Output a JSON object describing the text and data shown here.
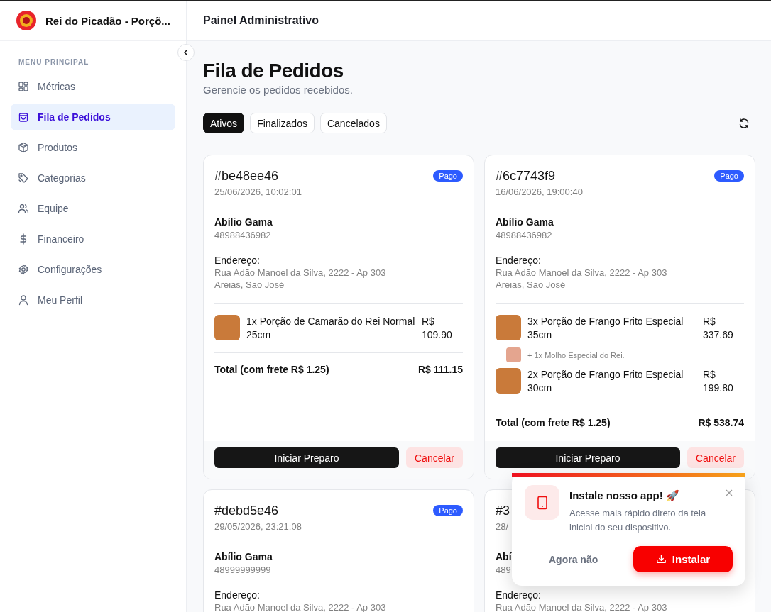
{
  "sidebar": {
    "brand": "Rei do Picadão - Porçõ...",
    "section_title": "MENU PRINCIPAL",
    "items": [
      {
        "label": "Métricas",
        "selected": false
      },
      {
        "label": "Fila de Pedidos",
        "selected": true
      },
      {
        "label": "Produtos",
        "selected": false
      },
      {
        "label": "Categorias",
        "selected": false
      },
      {
        "label": "Equipe",
        "selected": false
      },
      {
        "label": "Financeiro",
        "selected": false
      },
      {
        "label": "Configurações",
        "selected": false
      },
      {
        "label": "Meu Perfil",
        "selected": false
      }
    ]
  },
  "header": {
    "title": "Painel Administrativo"
  },
  "page": {
    "title": "Fila de Pedidos",
    "subtitle": "Gerencie os pedidos recebidos."
  },
  "tabs": [
    {
      "label": "Ativos",
      "selected": true
    },
    {
      "label": "Finalizados",
      "selected": false
    },
    {
      "label": "Cancelados",
      "selected": false
    }
  ],
  "orders": [
    {
      "id": "#be48ee46",
      "date": "25/06/2026, 10:02:01",
      "status": "Pago",
      "customer": "Abílio Gama",
      "phone": "48988436982",
      "address_label": "Endereço:",
      "address_lines": [
        "Rua Adão Manoel da Silva, 2222 - Ap 303",
        "Areias, São José"
      ],
      "items": [
        {
          "name": "1x Porção de Camarão do Rei Normal 25cm",
          "price": "R$ 109.90"
        }
      ],
      "total_label": "Total (com frete R$ 1.25)",
      "total": "R$ 111.15",
      "primary_action": "Iniciar Preparo",
      "secondary_action": "Cancelar"
    },
    {
      "id": "#6c7743f9",
      "date": "16/06/2026, 19:00:40",
      "status": "Pago",
      "customer": "Abílio Gama",
      "phone": "48988436982",
      "address_label": "Endereço:",
      "address_lines": [
        "Rua Adão Manoel da Silva, 2222 - Ap 303",
        "Areias, São José"
      ],
      "items": [
        {
          "name": "3x Porção de Frango Frito Especial 35cm",
          "price": "R$ 337.69",
          "extras": [
            "+ 1x Molho Especial do Rei."
          ]
        },
        {
          "name": "2x Porção de Frango Frito Especial 30cm",
          "price": "R$ 199.80"
        }
      ],
      "total_label": "Total (com frete R$ 1.25)",
      "total": "R$ 538.74",
      "primary_action": "Iniciar Preparo",
      "secondary_action": "Cancelar"
    },
    {
      "id": "#debd5e46",
      "date": "29/05/2026, 23:21:08",
      "status": "Pago",
      "customer": "Abílio Gama",
      "phone": "48999999999",
      "address_label": "Endereço:",
      "address_lines": [
        "Rua Adão Manoel da Silva, 2222 - Ap 303"
      ]
    },
    {
      "id": "#3",
      "date": "28/",
      "customer": "Abí",
      "phone": "489",
      "address_label": "Endereço:",
      "address_lines": [
        "Rua Adão Manoel da Silva, 2222 - Ap 303"
      ]
    }
  ],
  "install_prompt": {
    "title": "Instale nosso app! 🚀",
    "message": "Acesse mais rápido direto da tela inicial do seu dispositivo.",
    "dismiss": "Agora não",
    "install": "Instalar"
  }
}
